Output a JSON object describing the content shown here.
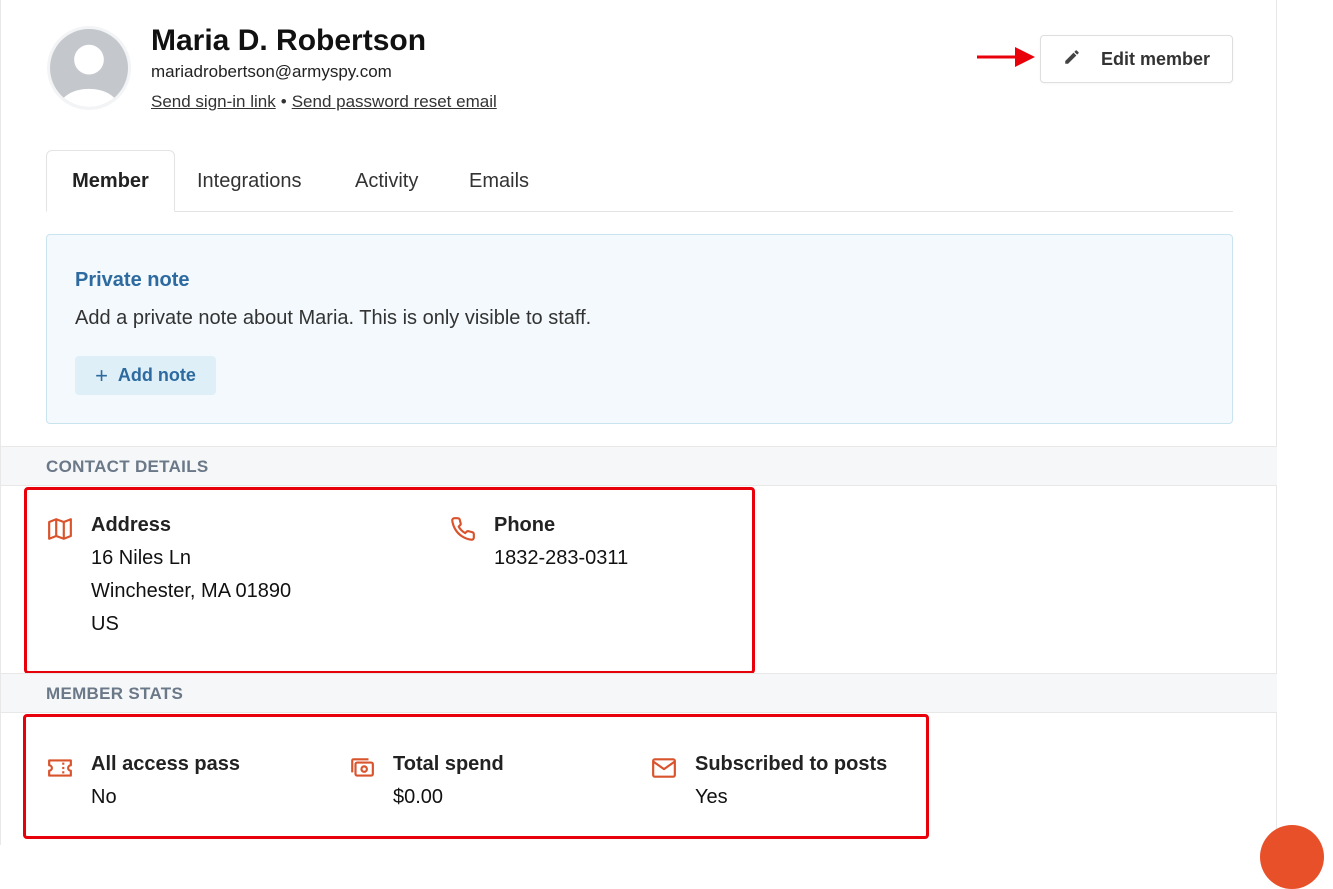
{
  "member": {
    "name": "Maria D. Robertson",
    "email": "mariadrobertson@armyspy.com",
    "send_signin": "Send sign-in link",
    "separator": "•",
    "send_reset": "Send password reset email",
    "edit_label": "Edit member"
  },
  "tabs": [
    {
      "label": "Member",
      "active": true
    },
    {
      "label": "Integrations",
      "active": false
    },
    {
      "label": "Activity",
      "active": false
    },
    {
      "label": "Emails",
      "active": false
    }
  ],
  "note": {
    "title": "Private note",
    "text": "Add a private note about Maria. This is only visible to staff.",
    "add_label": "Add note",
    "add_icon": "+"
  },
  "contact": {
    "heading": "CONTACT DETAILS",
    "address_label": "Address",
    "address_lines": [
      "16 Niles Ln",
      "Winchester, MA 01890",
      "US"
    ],
    "phone_label": "Phone",
    "phone": "1832-283-0311"
  },
  "stats": {
    "heading": "MEMBER STATS",
    "pass_label": "All access pass",
    "pass_value": "No",
    "spend_label": "Total spend",
    "spend_value": "$0.00",
    "subscribed_label": "Subscribed to posts",
    "subscribed_value": "Yes"
  },
  "colors": {
    "accent_blue": "#2c6aa0",
    "icon_orange": "#d9532c",
    "highlight_red": "#e8000b"
  },
  "icons": {
    "avatar": "default-user-avatar",
    "edit": "pencil-icon",
    "address": "map-icon",
    "phone": "phone-icon",
    "pass": "ticket-icon",
    "spend": "money-icon",
    "subscribed": "envelope-icon",
    "annotation": "red-arrow"
  }
}
